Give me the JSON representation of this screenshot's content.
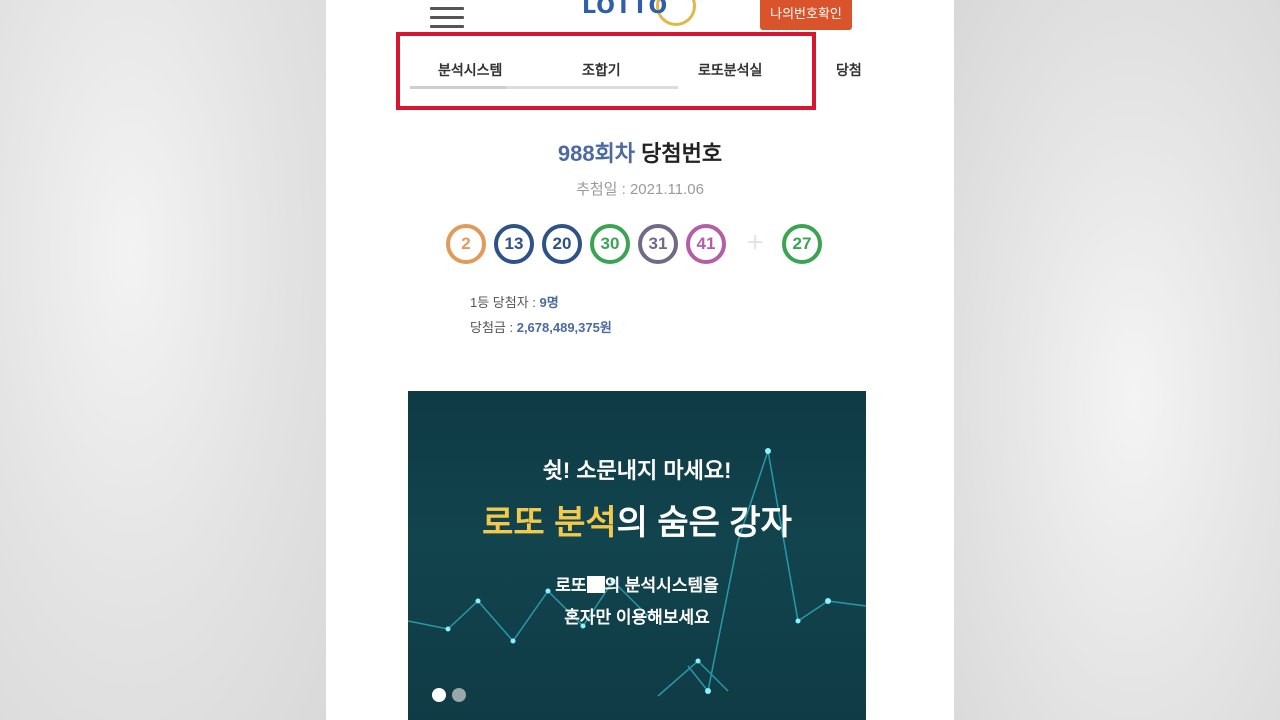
{
  "header": {
    "logo_text": "LOTTO",
    "my_numbers_button": "나의번호확인",
    "menu_icon": "hamburger-icon"
  },
  "tabs": [
    {
      "label": "분석시스템",
      "active": true
    },
    {
      "label": "조합기"
    },
    {
      "label": "로또분석실"
    },
    {
      "label": "당첨"
    }
  ],
  "draw": {
    "round": "988회차",
    "title_suffix": " 당첨번호",
    "date_label": "추첨일 : ",
    "date": "2021.11.06",
    "numbers": [
      "2",
      "13",
      "20",
      "30",
      "31",
      "41"
    ],
    "bonus": "27",
    "ball_colors": [
      "#e09b5a",
      "#2d5288",
      "#2d5288",
      "#3aa453",
      "#716a86",
      "#b35ea6"
    ],
    "bonus_color": "#3aa453",
    "first_prize_label": "1등 당첨자 : ",
    "first_prize_count": "9명",
    "prize_label": "당첨금 : ",
    "prize_amount": "2,678,489,375원"
  },
  "banner": {
    "line1": "쉿! 소문내지 마세요!",
    "line2_highlight": "로또 분석",
    "line2_rest": "의 숨은 강자",
    "line3_a": "로또",
    "line3_b": "의 분석시스템을",
    "line4": "혼자만 이용해보세요",
    "slides": 2,
    "active_slide": 0
  }
}
